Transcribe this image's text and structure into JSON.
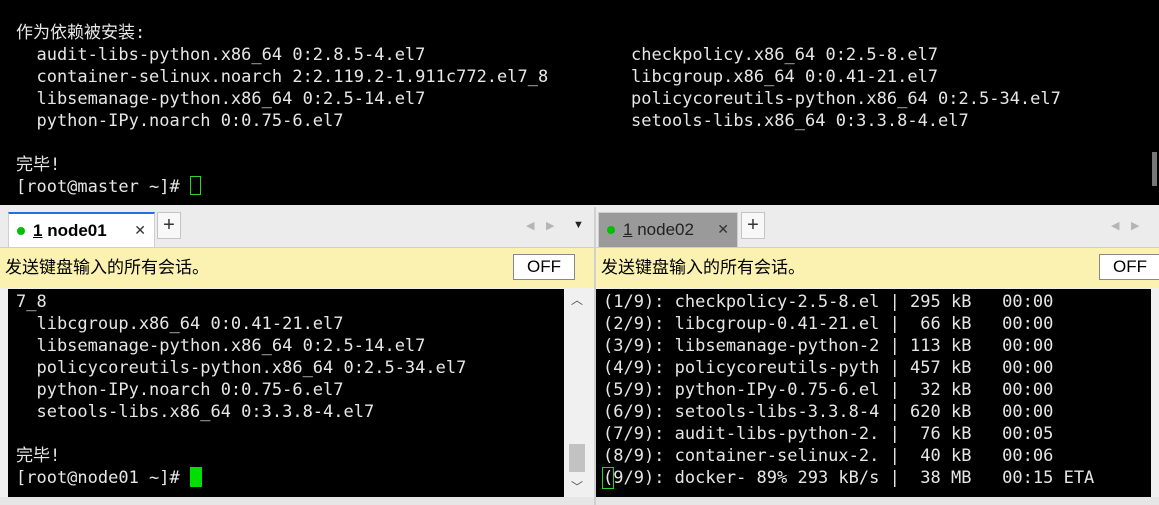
{
  "top_terminal": {
    "header": "作为依赖被安装:",
    "deps": [
      {
        "left": "  audit-libs-python.x86_64 0:2.8.5-4.el7",
        "right": "checkpolicy.x86_64 0:2.5-8.el7"
      },
      {
        "left": "  container-selinux.noarch 2:2.119.2-1.911c772.el7_8",
        "right": "libcgroup.x86_64 0:0.41-21.el7"
      },
      {
        "left": "  libsemanage-python.x86_64 0:2.5-14.el7",
        "right": "policycoreutils-python.x86_64 0:2.5-34.el7"
      },
      {
        "left": "  python-IPy.noarch 0:0.75-6.el7",
        "right": "setools-libs.x86_64 0:3.3.8-4.el7"
      }
    ],
    "done": "完毕!",
    "prompt": "[root@master ~]# "
  },
  "left_pane": {
    "tab_number": "1",
    "tab_name": "node01",
    "close": "✕",
    "add": "+",
    "notice": "发送键盘输入的所有会话。",
    "off_label": "OFF",
    "lines": [
      "7_8",
      "  libcgroup.x86_64 0:0.41-21.el7",
      "  libsemanage-python.x86_64 0:2.5-14.el7",
      "  policycoreutils-python.x86_64 0:2.5-34.el7",
      "  python-IPy.noarch 0:0.75-6.el7",
      "  setools-libs.x86_64 0:3.3.8-4.el7",
      "",
      "完毕!"
    ],
    "prompt": "[root@node01 ~]# "
  },
  "right_pane": {
    "tab_number": "1",
    "tab_name": "node02",
    "close": "✕",
    "add": "+",
    "notice": "发送键盘输入的所有会话。",
    "off_label": "OFF",
    "lines": [
      "(1/9): checkpolicy-2.5-8.el | 295 kB   00:00",
      "(2/9): libcgroup-0.41-21.el |  66 kB   00:00",
      "(3/9): libsemanage-python-2 | 113 kB   00:00",
      "(4/9): policycoreutils-pyth | 457 kB   00:00",
      "(5/9): python-IPy-0.75-6.el |  32 kB   00:00",
      "(6/9): setools-libs-3.3.8-4 | 620 kB   00:00",
      "(7/9): audit-libs-python-2. |  76 kB   00:05",
      "(8/9): container-selinux-2. |  40 kB   00:06"
    ],
    "last_line_first_char": "(",
    "last_line_rest": "9/9): docker- 89% 293 kB/s |  38 MB   00:15 ETA"
  },
  "icons": {
    "scroll_left": "◀",
    "scroll_right": "▶",
    "dropdown": "▼",
    "scroll_up": "︿",
    "scroll_down": "﹀"
  },
  "colors": {
    "terminal_bg": "#000000",
    "terminal_fg": "#e6e6e6",
    "cursor": "#00e000",
    "notice_bg": "#fbf1b0",
    "tab_active_accent": "#1a73e8",
    "session_dot": "#00c000"
  }
}
